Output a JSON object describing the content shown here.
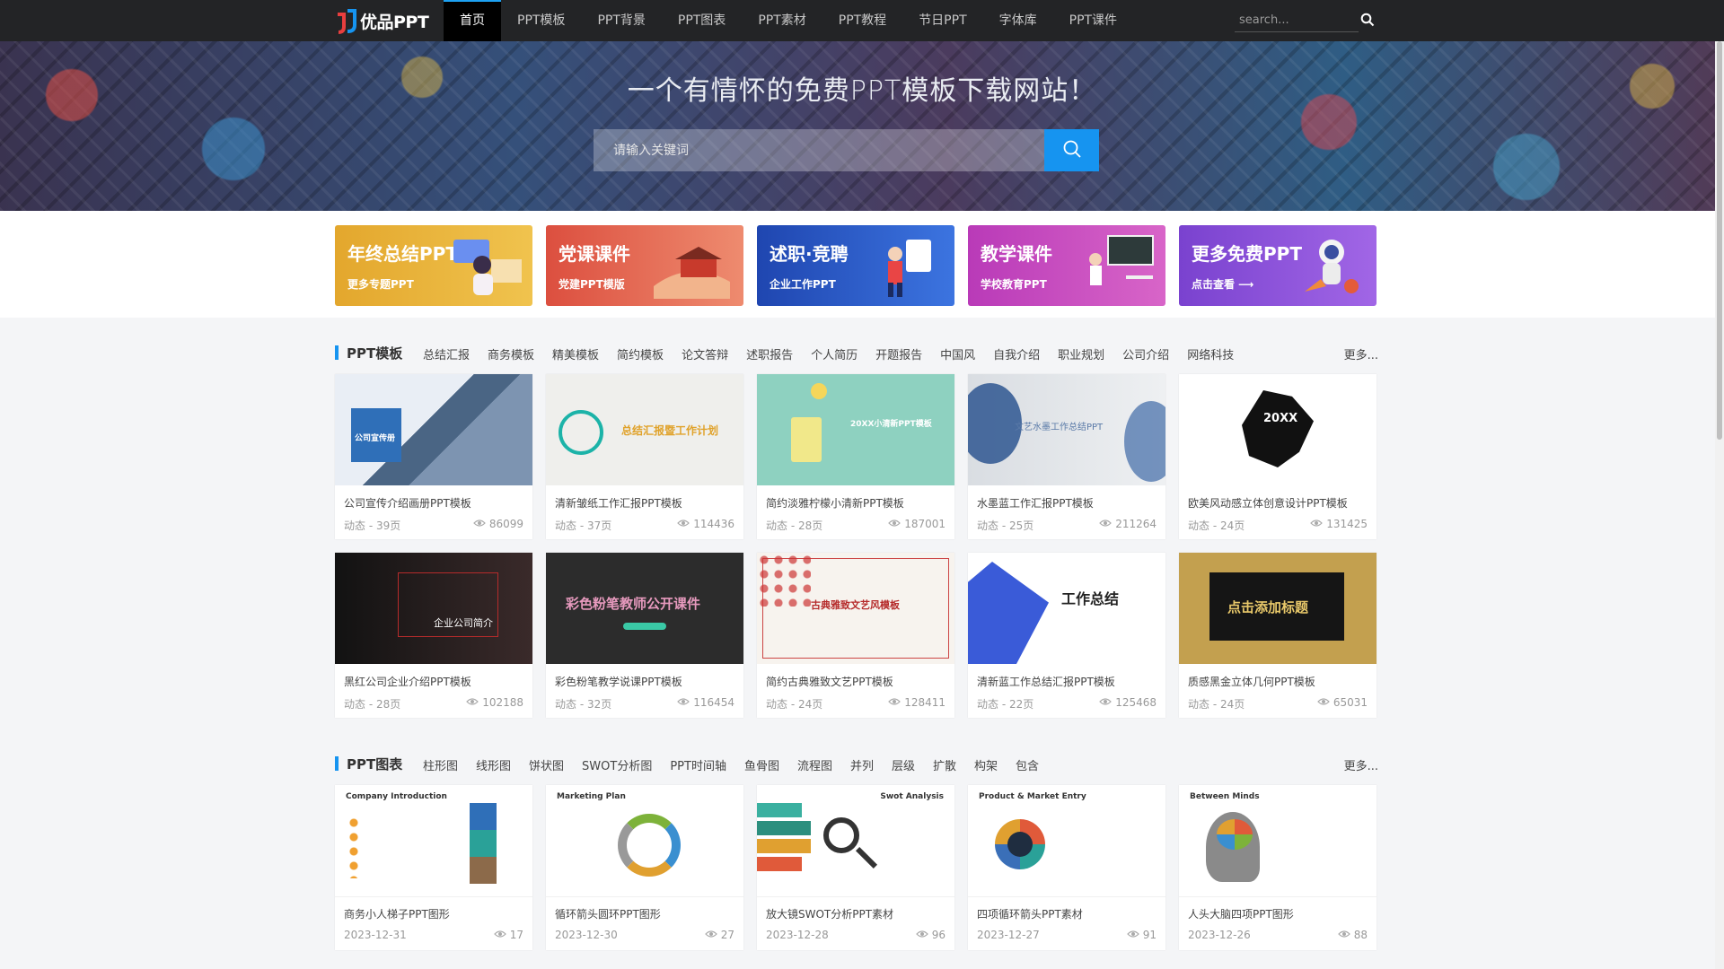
{
  "brand": {
    "logo_text": "优品PPT"
  },
  "nav": {
    "items": [
      {
        "label": "首页"
      },
      {
        "label": "PPT模板"
      },
      {
        "label": "PPT背景"
      },
      {
        "label": "PPT图表"
      },
      {
        "label": "PPT素材"
      },
      {
        "label": "PPT教程"
      },
      {
        "label": "节日PPT"
      },
      {
        "label": "字体库"
      },
      {
        "label": "PPT课件"
      }
    ],
    "search_placeholder": "search..."
  },
  "hero": {
    "title": "一个有情怀的免费PPT模板下载网站！",
    "search_placeholder": "请输入关键词"
  },
  "banners": [
    {
      "title": "年终总结PPT",
      "sub": "更多专题PPT",
      "color": "#e6b23a"
    },
    {
      "title": "党课课件",
      "sub": "党建PPT模版",
      "color": "#e0644f"
    },
    {
      "title": "述职·竞聘",
      "sub": "企业工作PPT",
      "color": "#2350b8"
    },
    {
      "title": "教学课件",
      "sub": "学校教育PPT",
      "color": "#c44bc0"
    },
    {
      "title": "更多免费PPT",
      "sub": "点击查看 ⟶",
      "color": "#8a4fd6"
    }
  ],
  "templates": {
    "title": "PPT模板",
    "tags": [
      "总结汇报",
      "商务模板",
      "精美模板",
      "简约模板",
      "论文答辩",
      "述职报告",
      "个人简历",
      "开题报告",
      "中国风",
      "自我介绍",
      "职业规划",
      "公司介绍",
      "网络科技"
    ],
    "more": "更多...",
    "cards": [
      {
        "name": "公司宣传介绍画册PPT模板",
        "meta": "动态 - 39页",
        "views": "86099",
        "thumb_text": "公司宣传册"
      },
      {
        "name": "清新皱纸工作汇报PPT模板",
        "meta": "动态 - 37页",
        "views": "114436",
        "thumb_text": "总结汇报暨工作计划"
      },
      {
        "name": "简约淡雅柠檬小清新PPT模板",
        "meta": "动态 - 28页",
        "views": "187001",
        "thumb_text": "20XX小清新PPT模板"
      },
      {
        "name": "水墨蓝工作汇报PPT模板",
        "meta": "动态 - 25页",
        "views": "211264",
        "thumb_text": "文艺水墨工作总结PPT"
      },
      {
        "name": "欧美风动感立体创意设计PPT模板",
        "meta": "动态 - 24页",
        "views": "131425",
        "thumb_text": "20XX"
      },
      {
        "name": "黑红公司企业介绍PPT模板",
        "meta": "动态 - 28页",
        "views": "102188",
        "thumb_text": "企业公司简介"
      },
      {
        "name": "彩色粉笔教学说课PPT模板",
        "meta": "动态 - 32页",
        "views": "116454",
        "thumb_text": "彩色粉笔教师公开课件"
      },
      {
        "name": "简约古典雅致文艺PPT模板",
        "meta": "动态 - 24页",
        "views": "128411",
        "thumb_text": "古典雅致文艺风模板"
      },
      {
        "name": "清新蓝工作总结汇报PPT模板",
        "meta": "动态 - 22页",
        "views": "125468",
        "thumb_text": "工作总结"
      },
      {
        "name": "质感黑金立体几何PPT模板",
        "meta": "动态 - 24页",
        "views": "65031",
        "thumb_text": "点击添加标题"
      }
    ]
  },
  "charts": {
    "title": "PPT图表",
    "tags": [
      "柱形图",
      "线形图",
      "饼状图",
      "SWOT分析图",
      "PPT时间轴",
      "鱼骨图",
      "流程图",
      "并列",
      "层级",
      "扩散",
      "构架",
      "包含"
    ],
    "more": "更多...",
    "cards": [
      {
        "name": "商务小人梯子PPT图形",
        "meta": "2023-12-31",
        "views": "17",
        "thumb_text": "Company Introduction"
      },
      {
        "name": "循环箭头圆环PPT图形",
        "meta": "2023-12-30",
        "views": "27",
        "thumb_text": "Marketing Plan"
      },
      {
        "name": "放大镜SWOT分析PPT素材",
        "meta": "2023-12-28",
        "views": "96",
        "thumb_text": "Swot Analysis"
      },
      {
        "name": "四项循环箭头PPT素材",
        "meta": "2023-12-27",
        "views": "91",
        "thumb_text": "Product & Market Entry"
      },
      {
        "name": "人头大脑四项PPT图形",
        "meta": "2023-12-26",
        "views": "88",
        "thumb_text": "Between Minds"
      }
    ]
  }
}
